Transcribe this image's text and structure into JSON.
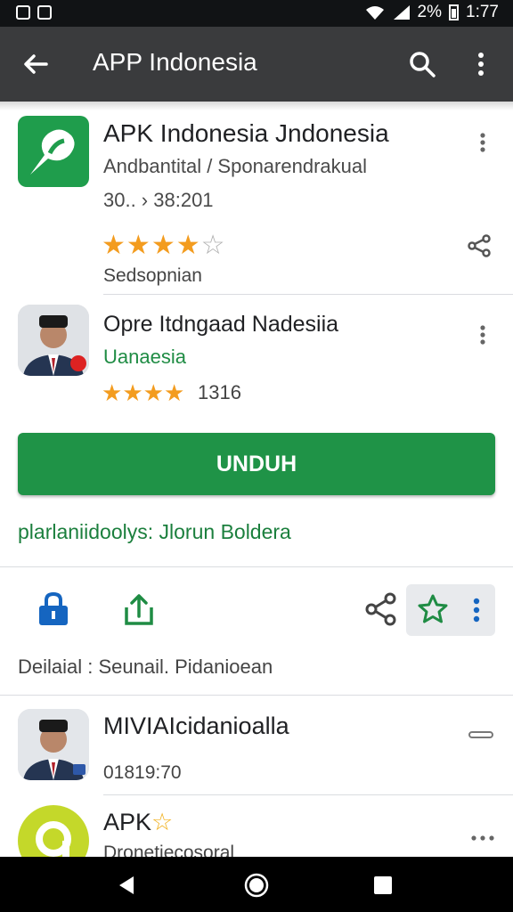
{
  "status_bar": {
    "battery": "2%",
    "time": "1:77"
  },
  "app_bar": {
    "title": "APP Indonesia",
    "icons": [
      "back-arrow-icon",
      "search-icon",
      "more-vert-icon"
    ]
  },
  "items": [
    {
      "title": "APK Indonesia Jndonesia",
      "subtitle": "Andbantital / Sponarendrakual",
      "meta": "30.. › 38:201",
      "rating_stars": 4,
      "label": "Sedsopnian"
    },
    {
      "title": "Opre Itdngaad Nadesiia",
      "subtitle": "Uanaesia",
      "rating_stars": 4,
      "rating_text": "1316"
    }
  ],
  "download_button": {
    "label": "UNDUH"
  },
  "info_line": "plarlaniidoolys: Jlorun Boldera",
  "actions": {
    "icons": [
      "lock-icon",
      "share-upload-icon",
      "share-icon",
      "star-icon",
      "more-vert-icon"
    ],
    "label": "Deilaial : Seunail. Pidanioean"
  },
  "more_items": [
    {
      "title": "MIVIAIcidanioalla",
      "subtitle": "01819:70"
    },
    {
      "title": "APK",
      "subtitle": "Dronetiecosoral"
    }
  ],
  "nav": {
    "icons": [
      "nav-back-icon",
      "nav-home-icon",
      "nav-recents-icon"
    ]
  },
  "colors": {
    "primary_green": "#1f9347",
    "star": "#f39c1f",
    "appbar": "#3a3b3d"
  }
}
